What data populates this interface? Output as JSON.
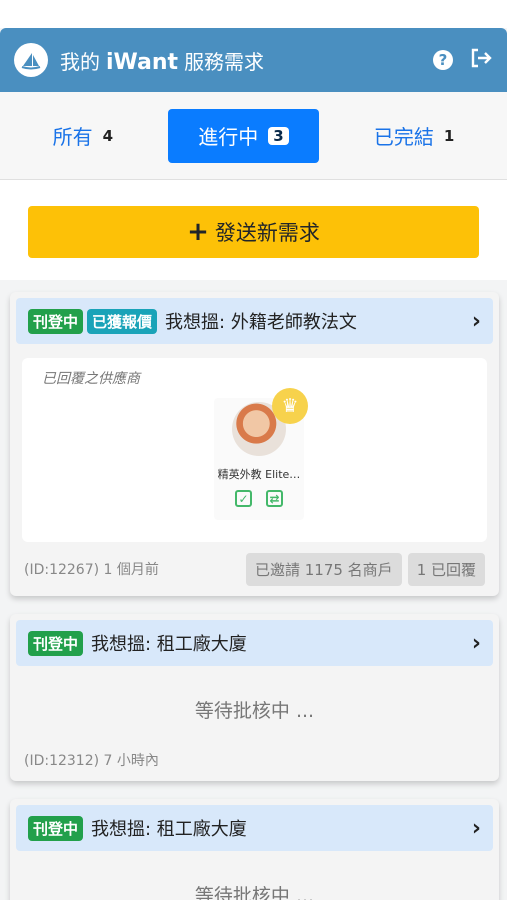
{
  "header": {
    "title_prefix": "我的",
    "brand": "iWant",
    "title_suffix": "服務需求"
  },
  "tabs": [
    {
      "label": "所有",
      "count": "4"
    },
    {
      "label": "進行中",
      "count": "3"
    },
    {
      "label": "已完結",
      "count": "1"
    }
  ],
  "send_button": {
    "label": "發送新需求"
  },
  "cards": [
    {
      "badge_status": "刊登中",
      "badge_quote": "已獲報價",
      "title": "我想搵: 外籍老師教法文",
      "vendors_label": "已回覆之供應商",
      "vendor_name": "精英外教 Elite…",
      "meta": "(ID:12267) 1 個月前",
      "invited": "已邀請 1175 名商戶",
      "replied": "1 已回覆"
    },
    {
      "badge_status": "刊登中",
      "title": "我想搵: 租工廠大廈",
      "pending": "等待批核中 ...",
      "meta": "(ID:12312) 7 小時內"
    },
    {
      "badge_status": "刊登中",
      "title": "我想搵: 租工廠大廈",
      "pending": "等待批核中 ..."
    }
  ],
  "colors": {
    "header_bg": "#4a8fc0",
    "active_tab": "#0a7cff",
    "send_button": "#fdc107",
    "badge_green": "#22a04b",
    "badge_teal": "#1aa3b8"
  }
}
